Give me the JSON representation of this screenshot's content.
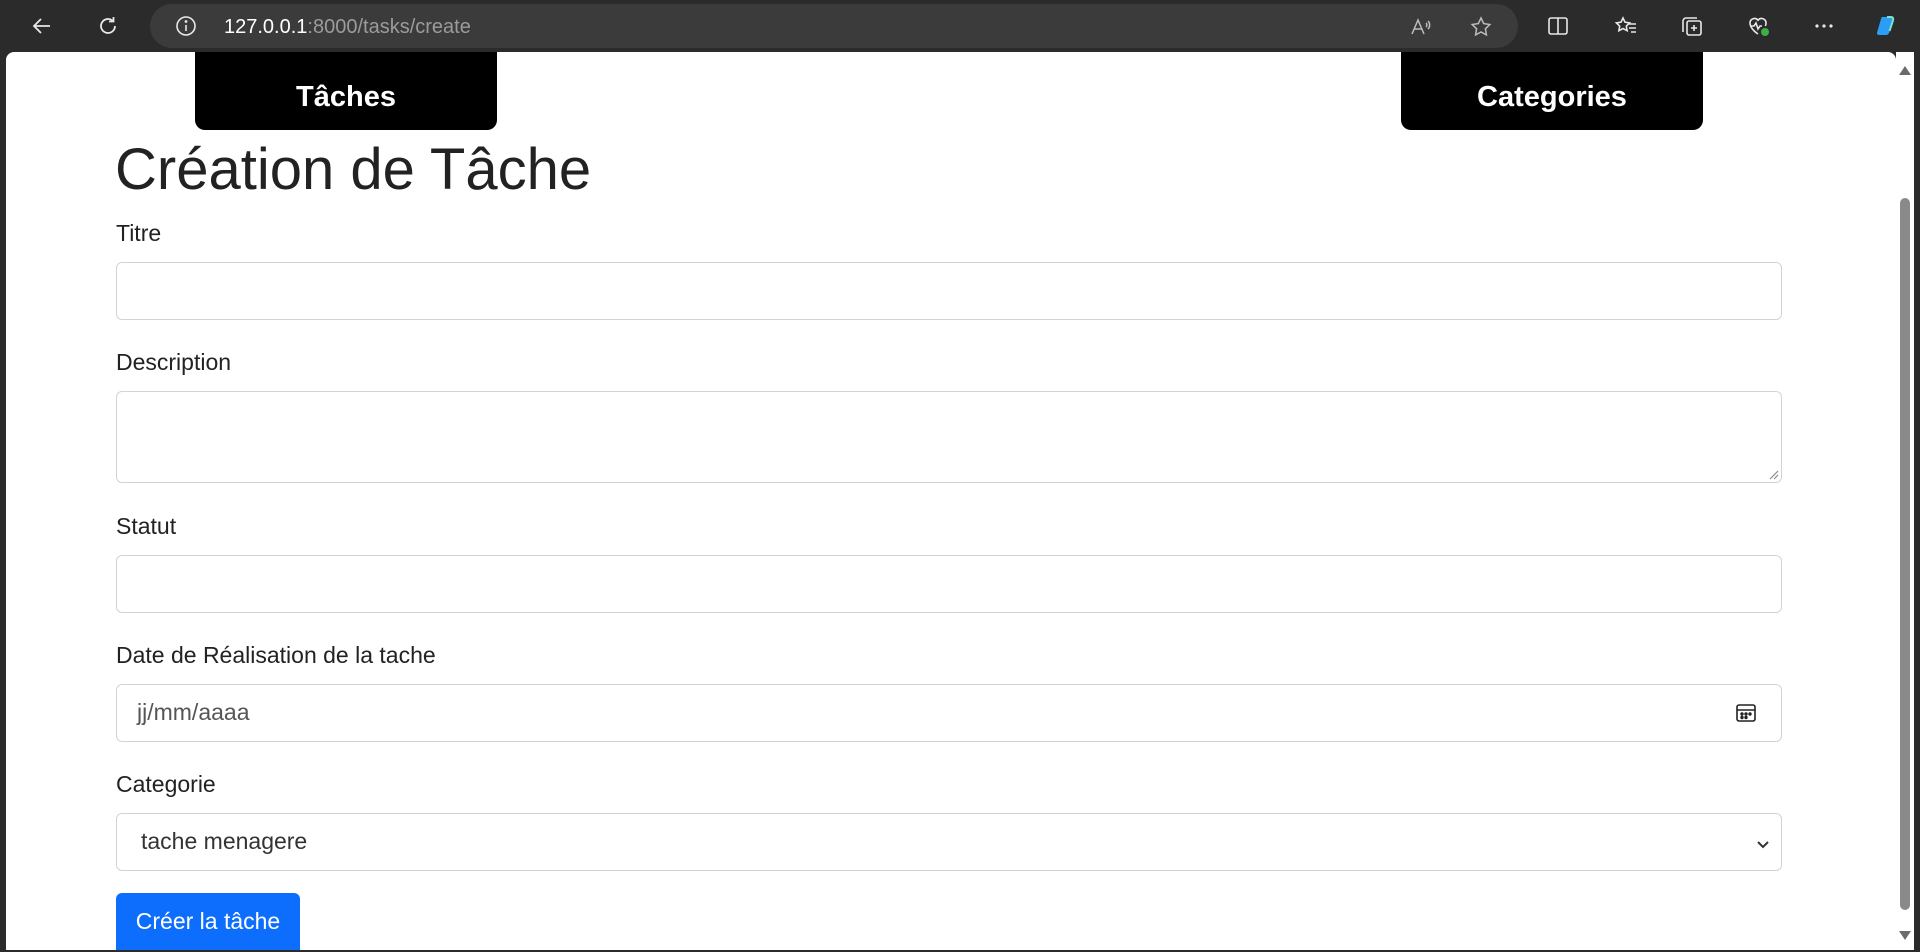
{
  "browser": {
    "url_host": "127.0.0.1",
    "url_path": ":8000/tasks/create"
  },
  "nav": {
    "taches": "Tâches",
    "categories": "Categories"
  },
  "page": {
    "title": "Création de Tâche"
  },
  "form": {
    "titre_label": "Titre",
    "titre_value": "",
    "description_label": "Description",
    "description_value": "",
    "statut_label": "Statut",
    "statut_value": "",
    "date_label": "Date de Réalisation de la tache",
    "date_placeholder": "jj/mm/aaaa",
    "categorie_label": "Categorie",
    "categorie_selected": "tache menagere",
    "submit_label": "Créer la tâche"
  },
  "colors": {
    "primary": "#0d6efd",
    "nav_bg": "#000000",
    "toolbar_bg": "#2b2b2b"
  }
}
